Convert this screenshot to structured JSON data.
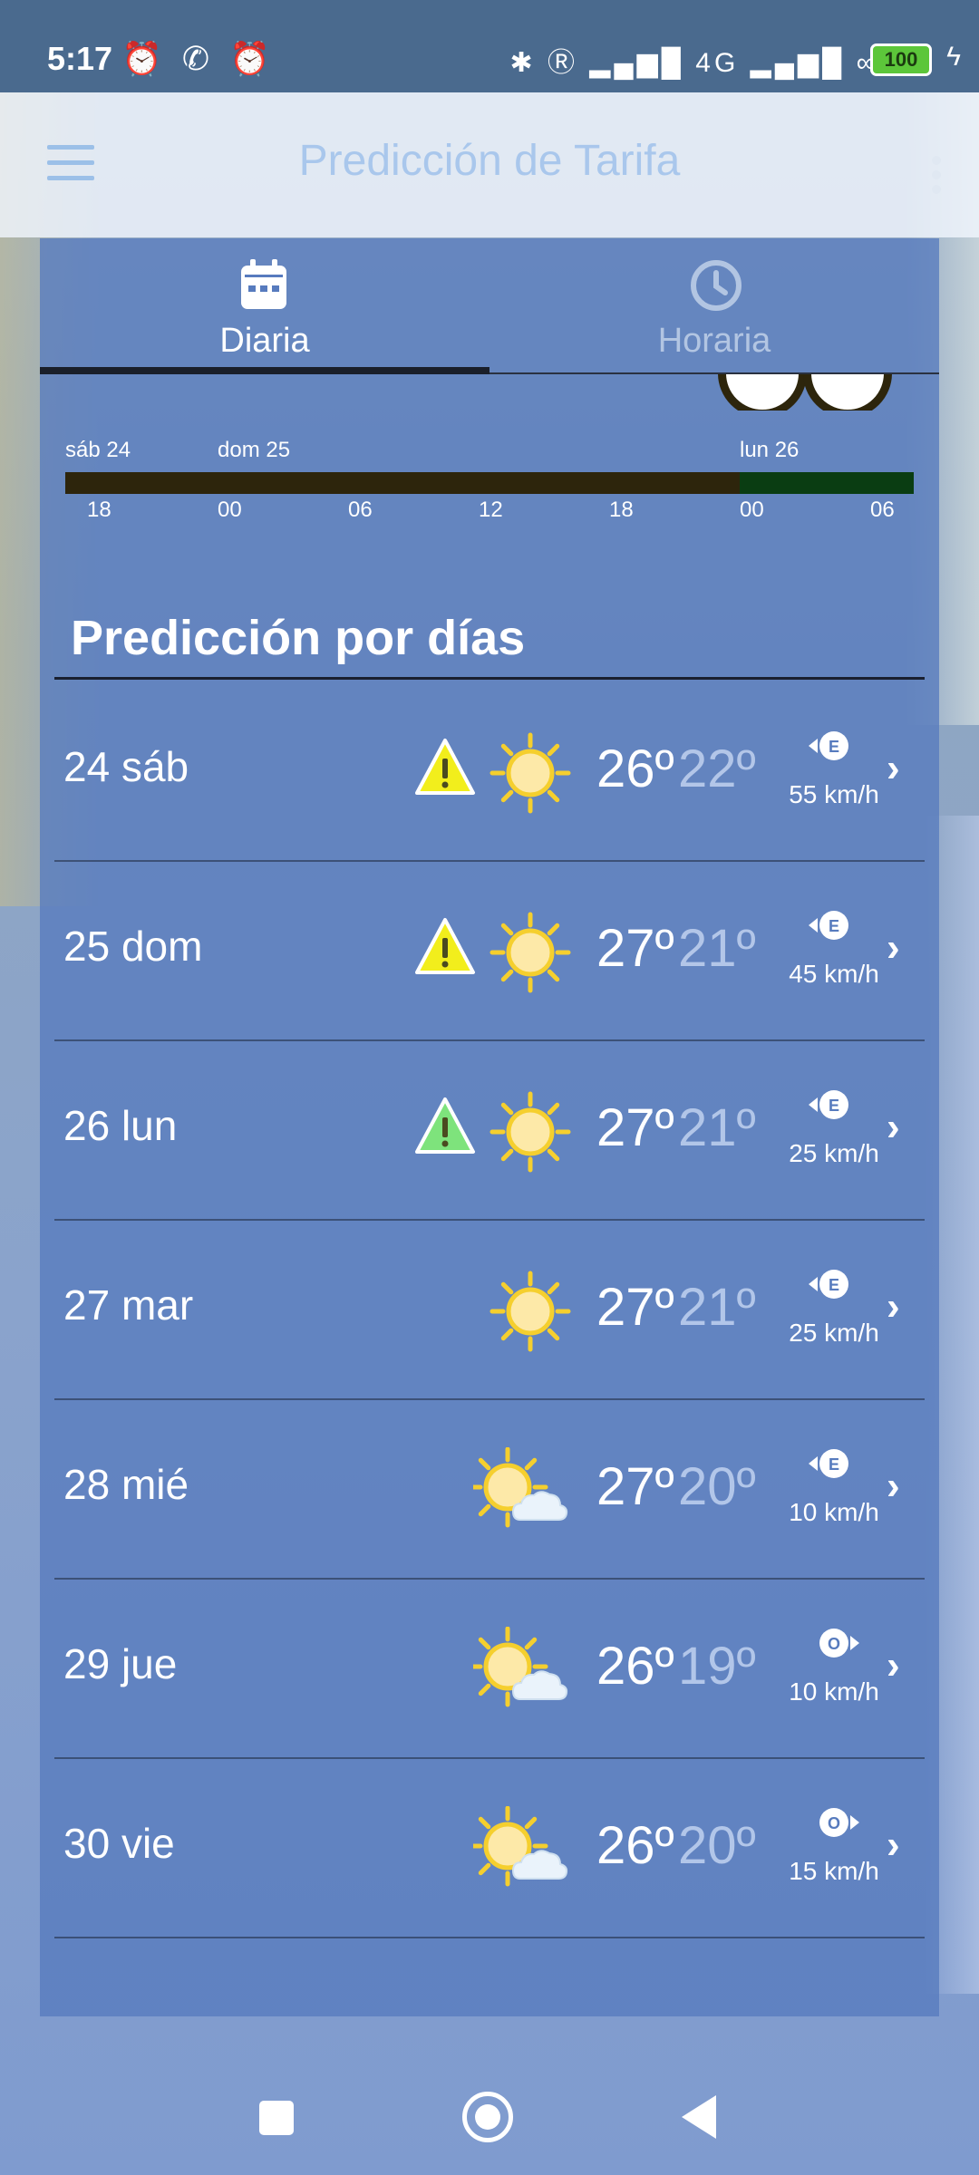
{
  "status_bar": {
    "time": "5:17",
    "left_icons": "⏰ ✆ ⏰",
    "right_icons": "✱ Ⓡ ▂▄▆█ 4G ▂▄▆█ ∞",
    "battery": "100"
  },
  "app_bar": {
    "title": "Predicción de Tarifa"
  },
  "tabs": [
    {
      "label": "Diaria",
      "icon": "calendar-icon",
      "active": true
    },
    {
      "label": "Horaria",
      "icon": "clock-icon",
      "active": false
    }
  ],
  "timeline": {
    "days": [
      "sáb 24",
      "dom 25",
      "lun 26"
    ],
    "hours": [
      "18",
      "00",
      "06",
      "12",
      "18",
      "00",
      "06"
    ],
    "colors": {
      "dark": "#2d250c",
      "green": "#0a3d12"
    }
  },
  "section": {
    "title": "Predicción por días"
  },
  "days": [
    {
      "day": "24 sáb",
      "warning": "yellow",
      "weather": "sunny",
      "tmax": "26º",
      "tmin": "22º",
      "wind_dir": "E",
      "wind_arrow": "left",
      "wind_speed": "55 km/h"
    },
    {
      "day": "25 dom",
      "warning": "yellow",
      "weather": "sunny",
      "tmax": "27º",
      "tmin": "21º",
      "wind_dir": "E",
      "wind_arrow": "left",
      "wind_speed": "45 km/h"
    },
    {
      "day": "26 lun",
      "warning": "green",
      "weather": "sunny",
      "tmax": "27º",
      "tmin": "21º",
      "wind_dir": "E",
      "wind_arrow": "left",
      "wind_speed": "25 km/h"
    },
    {
      "day": "27 mar",
      "warning": "none",
      "weather": "sunny",
      "tmax": "27º",
      "tmin": "21º",
      "wind_dir": "E",
      "wind_arrow": "left",
      "wind_speed": "25 km/h"
    },
    {
      "day": "28 mié",
      "warning": "none",
      "weather": "partly-cloudy",
      "tmax": "27º",
      "tmin": "20º",
      "wind_dir": "E",
      "wind_arrow": "left",
      "wind_speed": "10 km/h"
    },
    {
      "day": "29 jue",
      "warning": "none",
      "weather": "partly-cloudy",
      "tmax": "26º",
      "tmin": "19º",
      "wind_dir": "O",
      "wind_arrow": "right",
      "wind_speed": "10 km/h"
    },
    {
      "day": "30 vie",
      "warning": "none",
      "weather": "partly-cloudy",
      "tmax": "26º",
      "tmin": "20º",
      "wind_dir": "O",
      "wind_arrow": "right",
      "wind_speed": "15 km/h"
    }
  ],
  "colors": {
    "warning_yellow": "#f2ee1c",
    "warning_green": "#7ee37c",
    "sun": "#f5cf2e",
    "card": "#577bbe"
  }
}
